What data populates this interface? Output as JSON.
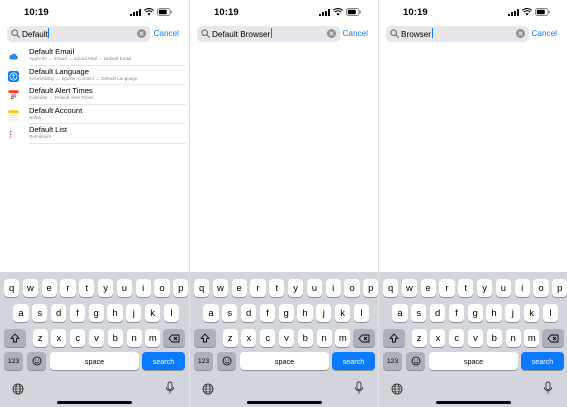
{
  "status": {
    "time": "10:19"
  },
  "keyboard": {
    "rows": [
      [
        "q",
        "w",
        "e",
        "r",
        "t",
        "y",
        "u",
        "i",
        "o",
        "p"
      ],
      [
        "a",
        "s",
        "d",
        "f",
        "g",
        "h",
        "j",
        "k",
        "l"
      ],
      [
        "z",
        "x",
        "c",
        "v",
        "b",
        "n",
        "m"
      ]
    ],
    "numbers_label": "123",
    "space_label": "space",
    "search_label": "search"
  },
  "panels": [
    {
      "search": {
        "value": "Default",
        "cancel": "Cancel"
      },
      "results": [
        {
          "title": "Default Email",
          "path": "Apple ID → iCloud → iCloud Mail → Default Email",
          "icon": "icloud-icon",
          "color": "#2e86e6"
        },
        {
          "title": "Default Language",
          "path": "Accessibility → Spoken Content → Default Language",
          "icon": "accessibility-icon",
          "color": "#0a7aff"
        },
        {
          "title": "Default Alert Times",
          "path": "Calendar → Default Alert Times",
          "icon": "calendar-icon",
          "color": "#ff3b30"
        },
        {
          "title": "Default Account",
          "path": "Notes",
          "icon": "notes-icon",
          "color": "#ffcc00"
        },
        {
          "title": "Default List",
          "path": "Reminders",
          "icon": "reminders-icon",
          "color": "#ff9500"
        }
      ]
    },
    {
      "search": {
        "value": "Default Browser",
        "cancel": "Cancel"
      },
      "results": []
    },
    {
      "search": {
        "value": "Browser",
        "cancel": "Cancel"
      },
      "results": []
    }
  ],
  "colors": {
    "accent": "#0a7aff",
    "field": "#e6e6eb",
    "keyboard": "#d2d5db"
  }
}
